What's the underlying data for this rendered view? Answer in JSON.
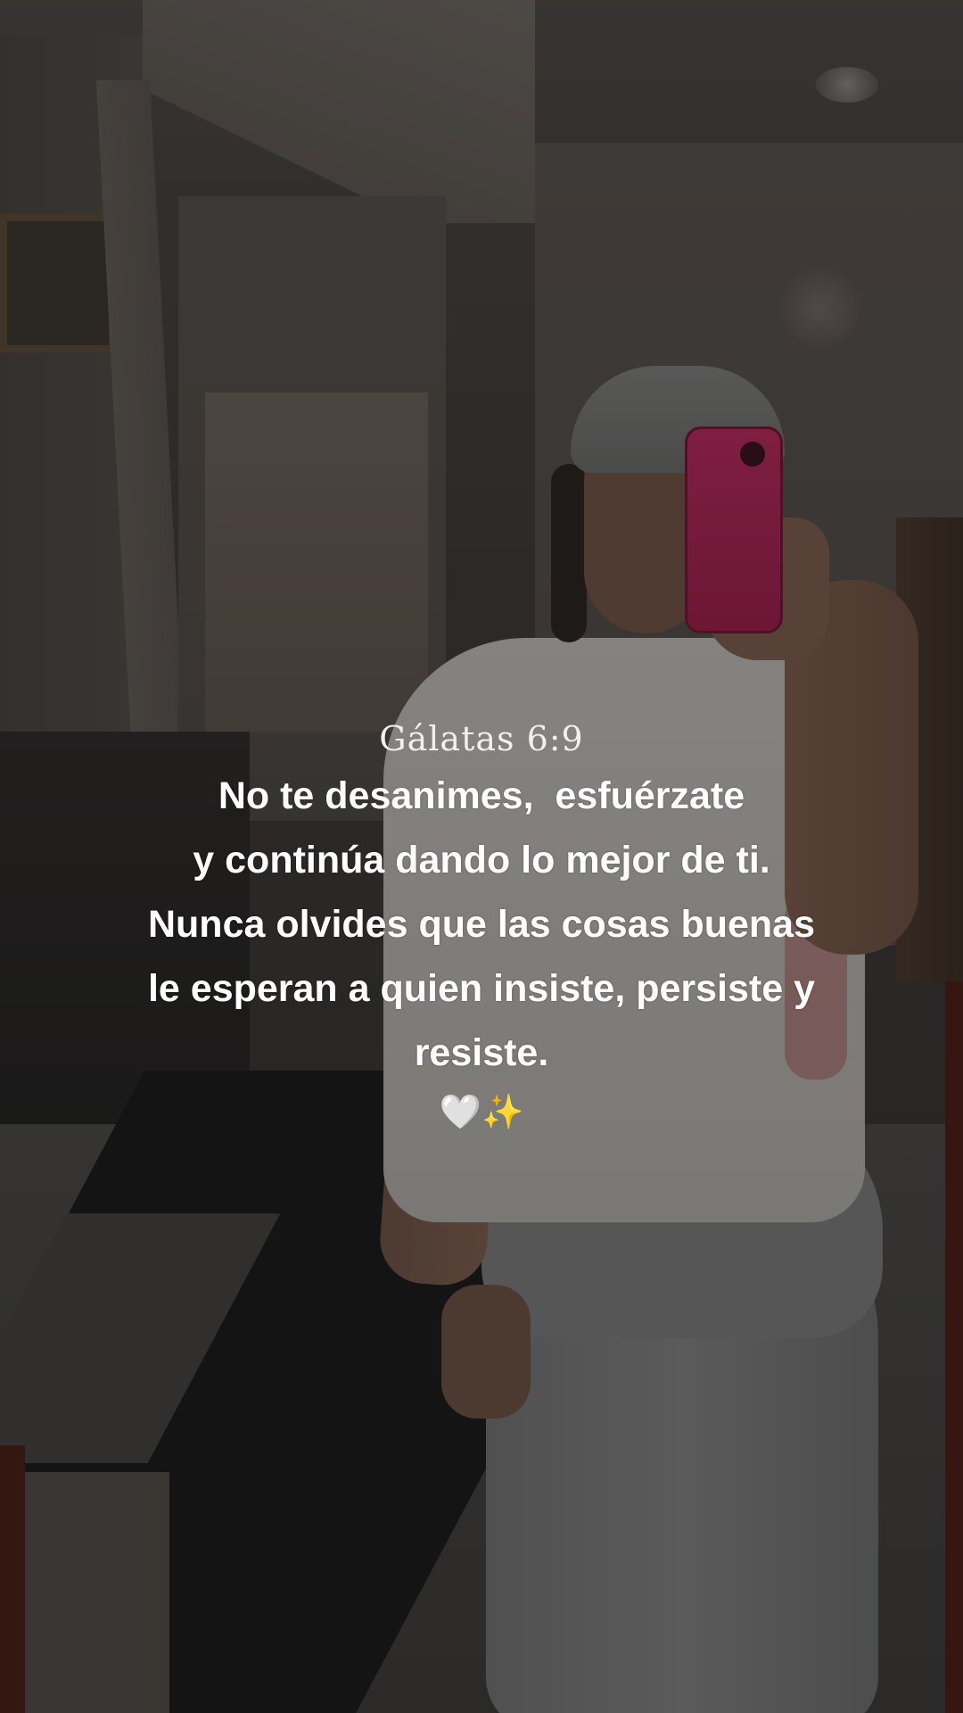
{
  "overlay": {
    "reference": "Gálatas 6:9",
    "lines": [
      "No te desanimes,  esfuérzate",
      "y continúa dando lo mejor de ti.",
      "Nunca olvides que las cosas buenas",
      "le esperan a quien insiste, persiste y",
      "resiste."
    ],
    "emoji_heart": "🤍",
    "emoji_sparkles": "✨"
  }
}
